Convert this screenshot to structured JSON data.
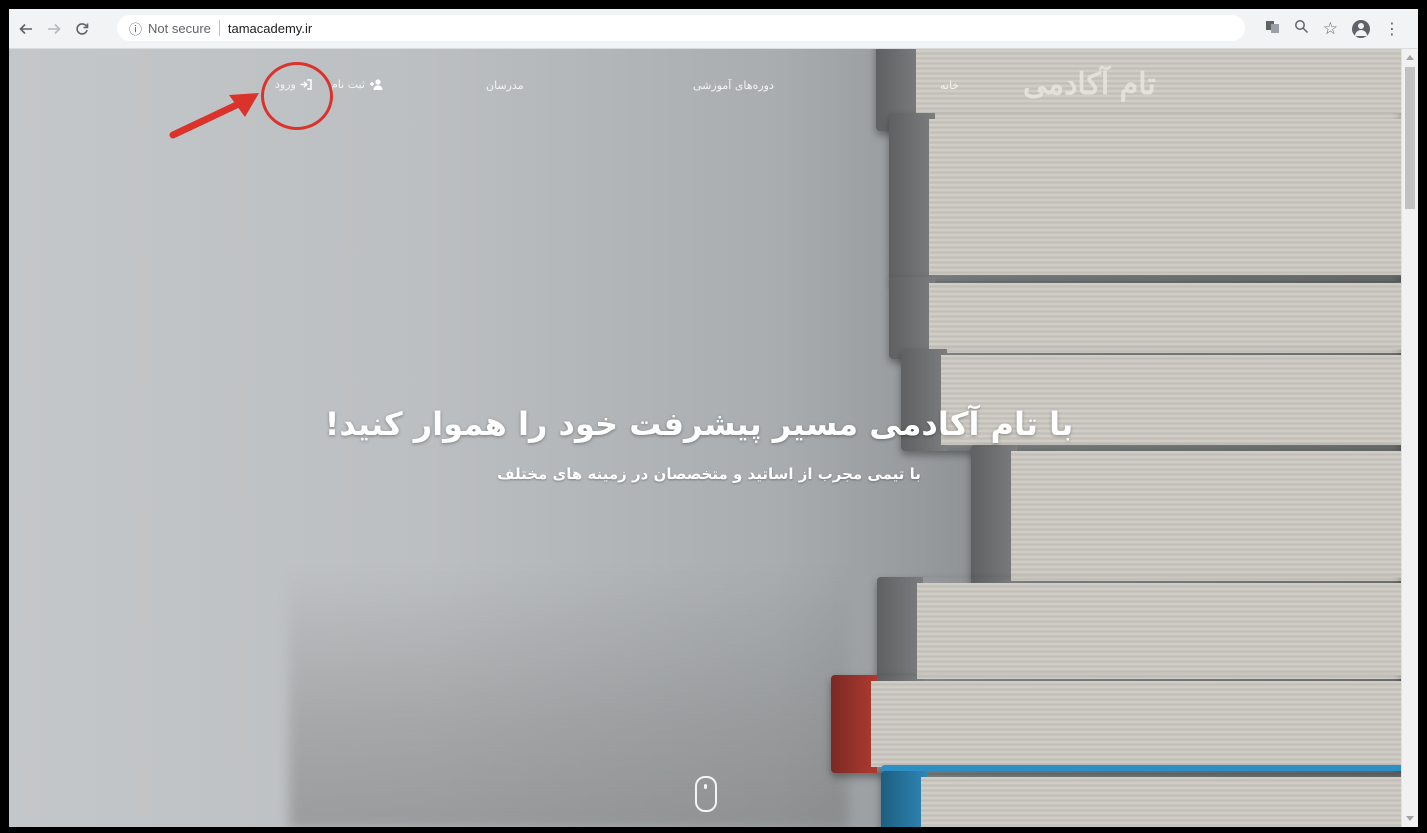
{
  "browser": {
    "security_label": "Not secure",
    "url": "tamacademy.ir",
    "info_icon": "info-icon",
    "back_icon": "arrow-left-icon",
    "forward_icon": "arrow-right-icon",
    "reload_icon": "reload-icon",
    "right_icons": [
      "translate-icon",
      "zoom-icon",
      "star-icon",
      "account-icon",
      "menu-dots-icon"
    ]
  },
  "site": {
    "logo": "تام آکادمی",
    "nav": {
      "home": "خانه",
      "courses": "دوره‌های آموزشی",
      "instructors": "مدرسان",
      "register": "ثبت نام",
      "login": "ورود"
    },
    "hero": {
      "title": "با تام آکادمی مسیر پیشرفت خود را هموار کنید!",
      "subtitle": "با تیمی مجرب از اساتید و متخصصان در زمینه های مختلف"
    }
  },
  "annotation": {
    "color": "#d9332c",
    "target": "login-link"
  }
}
